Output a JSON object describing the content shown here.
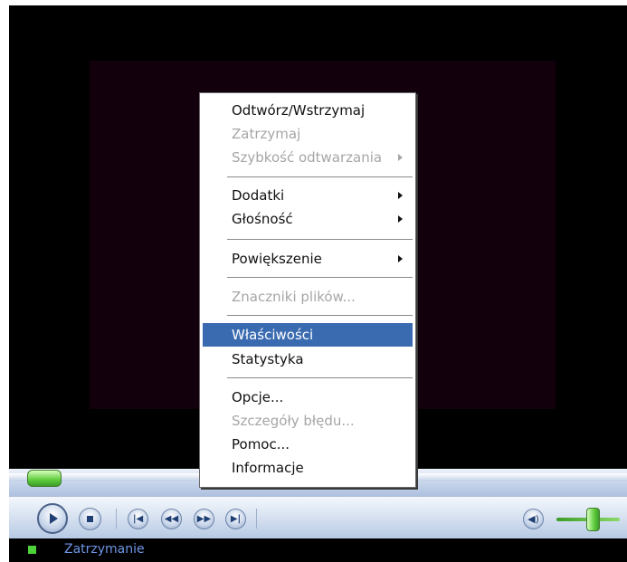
{
  "menu": {
    "items": [
      {
        "label": "Odtwórz/Wstrzymaj",
        "disabled": false,
        "submenu": false
      },
      {
        "label": "Zatrzymaj",
        "disabled": true,
        "submenu": false
      },
      {
        "label": "Szybkość odtwarzania",
        "disabled": true,
        "submenu": true
      },
      {
        "label": "Dodatki",
        "disabled": false,
        "submenu": true
      },
      {
        "label": "Głośność",
        "disabled": false,
        "submenu": true
      },
      {
        "label": "Powiększenie",
        "disabled": false,
        "submenu": true
      },
      {
        "label": "Znaczniki plików...",
        "disabled": true,
        "submenu": false
      },
      {
        "label": "Właściwości",
        "disabled": false,
        "submenu": false,
        "highlighted": true
      },
      {
        "label": "Statystyka",
        "disabled": false,
        "submenu": false
      },
      {
        "label": "Opcje...",
        "disabled": false,
        "submenu": false
      },
      {
        "label": "Szczegóły błędu...",
        "disabled": true,
        "submenu": false
      },
      {
        "label": "Pomoc...",
        "disabled": false,
        "submenu": false
      },
      {
        "label": "Informacje",
        "disabled": false,
        "submenu": false
      }
    ]
  },
  "controls": {
    "play_icon": "play-icon",
    "stop_icon": "stop-icon",
    "prev_icon": "previous-icon",
    "rewind_icon": "rewind-icon",
    "forward_icon": "fast-forward-icon",
    "next_icon": "next-icon",
    "mute_icon": "speaker-icon",
    "seek_position": 0.02,
    "volume_level": 0.65
  },
  "status": {
    "text": "Zatrzymanie"
  },
  "colors": {
    "highlight": "#3a6bb0",
    "status_text": "#6f95e6",
    "accent_green": "#5fcc3c",
    "disabled_text": "#a6a6a6"
  }
}
